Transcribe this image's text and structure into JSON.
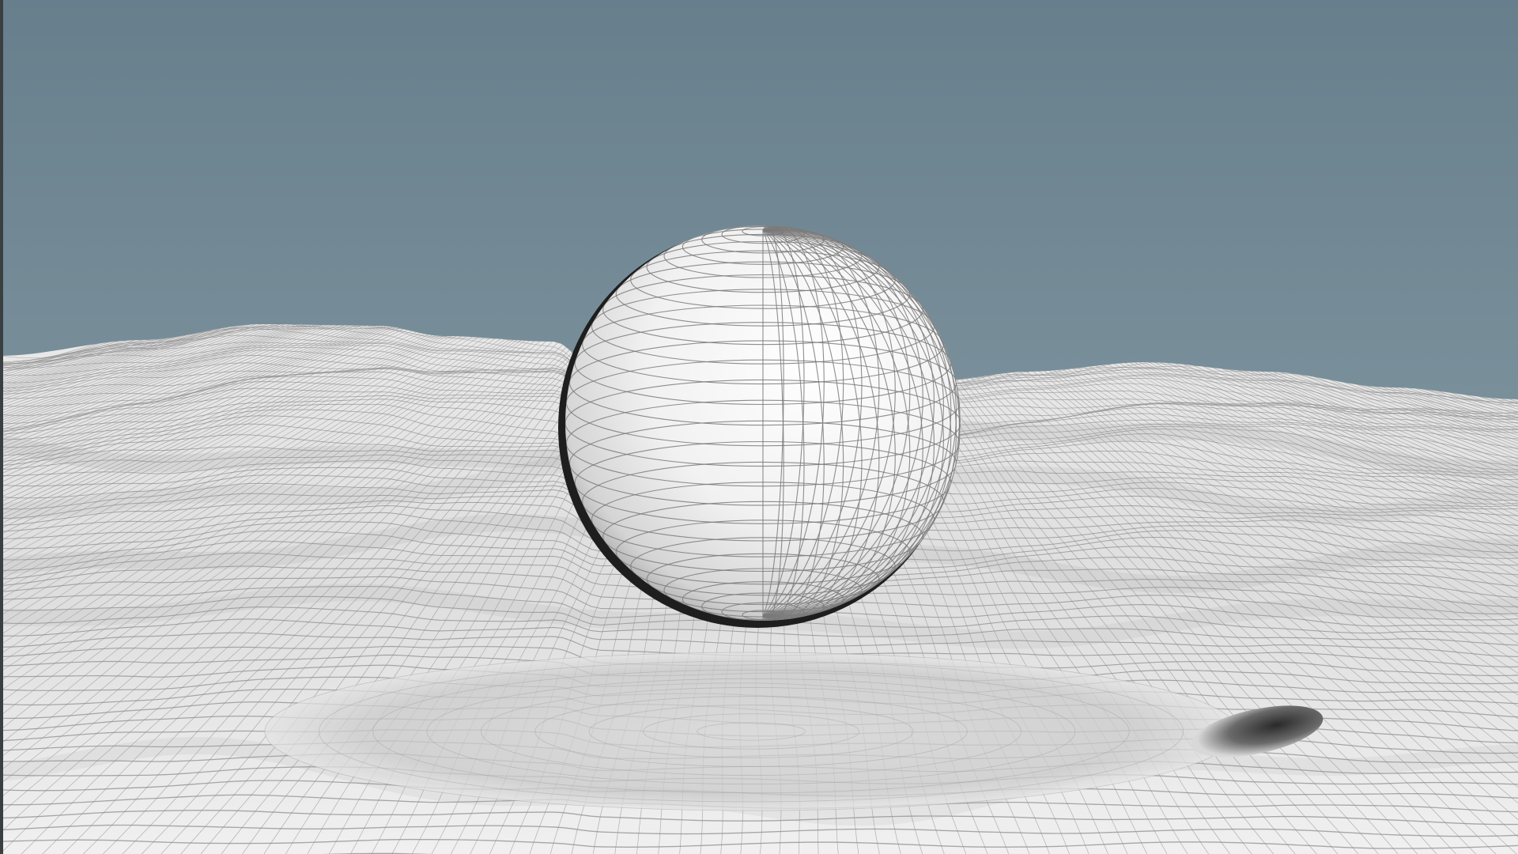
{
  "viewport": {
    "label": "",
    "sky_top_color": "#677f8c",
    "sky_horizon_color": "#8aa0a9",
    "terrain_color": "#ededed",
    "terrain_shade_color": "#cfcfcf",
    "wire_color": "#8e8e8e",
    "sphere_color": "#f6f6f6",
    "sphere_wire_color": "#7a7a7a",
    "shadow_color": "#1c1c1c"
  },
  "scene_objects": [
    {
      "name": "sphere",
      "icon": "sphere-mesh"
    },
    {
      "name": "terrain",
      "icon": "terrain-mesh"
    }
  ]
}
